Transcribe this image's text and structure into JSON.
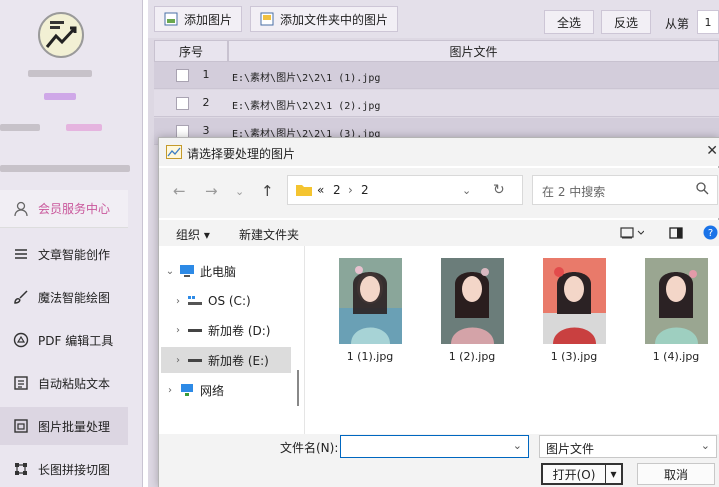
{
  "sidebar": {
    "menu": [
      {
        "label": "会员服务中心",
        "icon": "user-icon"
      },
      {
        "label": "文章智能创作",
        "icon": "menu-lines-icon"
      },
      {
        "label": "魔法智能绘图",
        "icon": "brush-icon"
      },
      {
        "label": "PDF 编辑工具",
        "icon": "pdf-circle-icon"
      },
      {
        "label": "自动粘贴文本",
        "icon": "clipboard-icon"
      },
      {
        "label": "图片批量处理",
        "icon": "image-frame-icon"
      },
      {
        "label": "长图拼接切图",
        "icon": "grid-corners-icon"
      }
    ]
  },
  "toolbar": {
    "add_image": "添加图片",
    "add_folder_images": "添加文件夹中的图片",
    "select_all": "全选",
    "invert_selection": "反选",
    "from_index_label": "从第",
    "from_index_value": "1"
  },
  "table": {
    "columns": [
      "序号",
      "图片文件"
    ],
    "rows": [
      {
        "index": "1",
        "file": "E:\\素材\\图片\\2\\2\\1 (1).jpg"
      },
      {
        "index": "2",
        "file": "E:\\素材\\图片\\2\\2\\1 (2).jpg"
      },
      {
        "index": "3",
        "file": "E:\\素材\\图片\\2\\2\\1 (3).jpg"
      }
    ]
  },
  "dialog": {
    "title": "请选择要处理的图片",
    "close": "✕",
    "breadcrumb": {
      "prefix": "«",
      "parts": [
        "2",
        "2"
      ]
    },
    "search_placeholder": "在 2 中搜索",
    "organize": "组织 ▾",
    "new_folder": "新建文件夹",
    "nav": [
      {
        "label": "此电脑",
        "expanded": true
      },
      {
        "label": "OS (C:)"
      },
      {
        "label": "新加卷 (D:)"
      },
      {
        "label": "新加卷 (E:)",
        "selected": true
      },
      {
        "label": "网络"
      }
    ],
    "files": [
      "1 (1).jpg",
      "1 (2).jpg",
      "1 (3).jpg",
      "1 (4).jpg"
    ],
    "filename_label": "文件名(N):",
    "filename_value": "",
    "filetype": "图片文件",
    "open_button": "打开(O)",
    "cancel_button": "取消"
  },
  "colors": {
    "accent_blue": "#0067c0",
    "highlight_pink": "#c9579b",
    "sidebar_bg": "#eae6ef"
  }
}
